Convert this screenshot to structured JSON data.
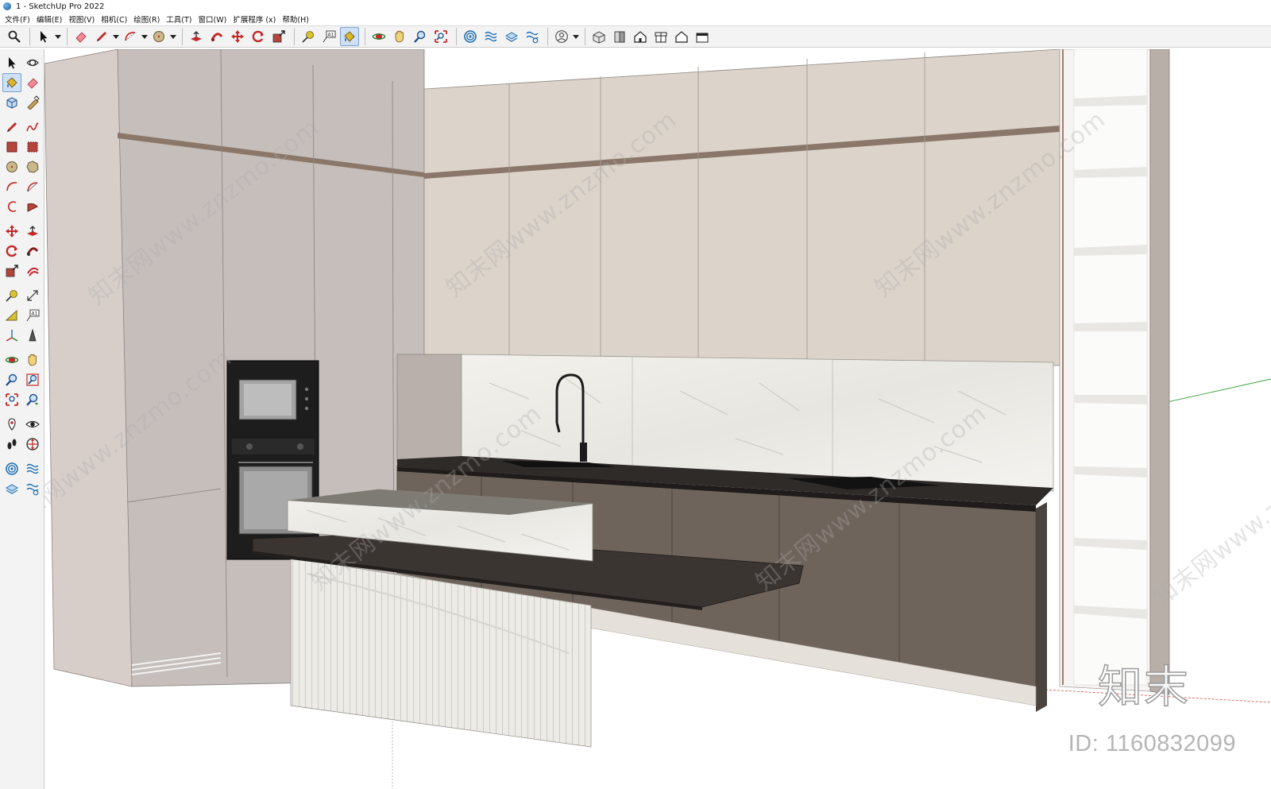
{
  "window": {
    "title": "1 - SketchUp Pro 2022"
  },
  "menu": [
    {
      "label": "文件(F)"
    },
    {
      "label": "编辑(E)"
    },
    {
      "label": "视图(V)"
    },
    {
      "label": "相机(C)"
    },
    {
      "label": "绘图(R)"
    },
    {
      "label": "工具(T)"
    },
    {
      "label": "窗口(W)"
    },
    {
      "label": "扩展程序 (x)"
    },
    {
      "label": "帮助(H)"
    }
  ],
  "toolbar": {
    "icons": [
      "search-icon",
      "select-arrow-icon",
      "eraser-icon",
      "pencil-line-icon",
      "arc-icon",
      "circle-icon",
      "push-pull-icon",
      "follow-me-icon",
      "move-icon",
      "rotate-icon",
      "scale-icon",
      "tape-measure-icon",
      "text-icon",
      "paint-bucket-icon",
      "orbit-icon",
      "pan-icon",
      "zoom-icon",
      "zoom-extents-icon",
      "sandbox-from-contours-icon",
      "sandbox-from-scratch-icon",
      "sandbox-smoove-icon",
      "sandbox-stamp-icon",
      "account-icon",
      "iso-view-icon",
      "top-view-icon",
      "front-view-icon",
      "right-view-icon",
      "back-view-icon",
      "left-view-icon"
    ]
  },
  "sidebar": {
    "icons": [
      "select-icon",
      "orbit-3d-icon",
      "paint-bucket-icon",
      "eraser-icon",
      "component-icon",
      "tape-icon",
      "pencil-icon",
      "freehand-icon",
      "rectangle-icon",
      "rotated-rectangle-icon",
      "circle-icon",
      "polygon-icon",
      "arc-icon",
      "two-point-arc-icon",
      "three-point-arc-icon",
      "pie-icon",
      "move-icon",
      "push-pull-icon",
      "rotate-icon",
      "follow-me-icon",
      "scale-icon",
      "offset-icon",
      "tape-measure-icon",
      "dimension-icon",
      "protractor-icon",
      "text-3d-icon",
      "axes-icon",
      "3d-text-icon",
      "orbit-icon",
      "pan-icon",
      "zoom-icon",
      "zoom-window-icon",
      "zoom-extents-icon",
      "previous-view-icon",
      "position-camera-icon",
      "look-around-icon",
      "walk-icon",
      "section-plane-icon",
      "sandbox-contours-icon",
      "sandbox-scratch-icon",
      "sandbox-smoove-icon",
      "sandbox-stamp-icon"
    ]
  },
  "overlay": {
    "watermark_text": "知末网www.znzmo.com",
    "logo": "知末",
    "id_text": "ID: 1160832099"
  },
  "colors": {
    "tall_cabinet": "#cfc7c2",
    "upper_cabinet": "#ddd4cc",
    "trim": "#8a776a",
    "base_cabinet": "#6f645c",
    "countertop": "#2f2b29",
    "island_counter": "#3b3532",
    "marble": "#ecebe6",
    "appliance": "#1c1c1c"
  }
}
